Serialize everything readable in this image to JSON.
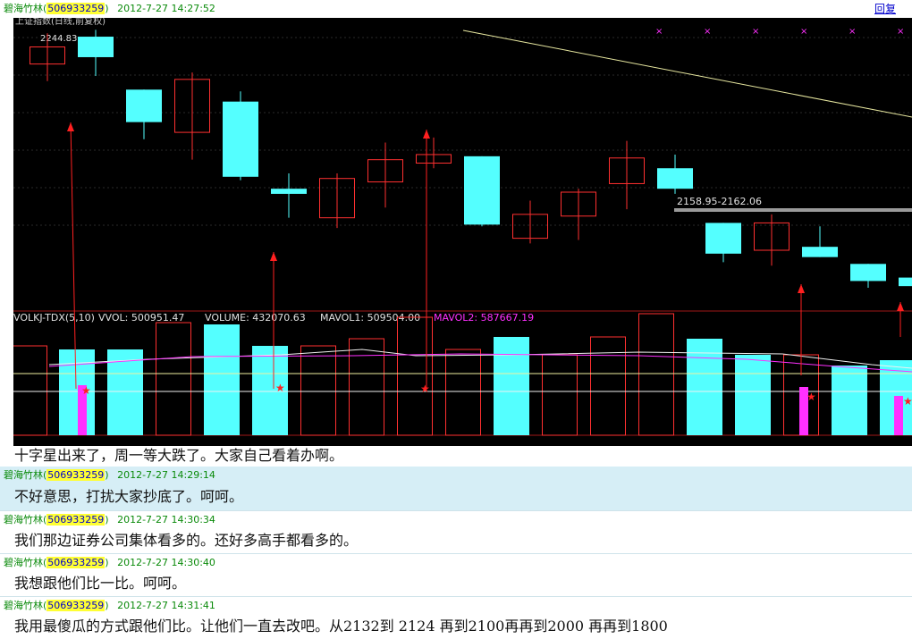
{
  "reply_label": "回复",
  "messages": [
    {
      "name": "碧海竹林",
      "qq": "506933259",
      "time": "2012-7-27 14:27:52",
      "text": ""
    },
    {
      "name": "",
      "qq": "",
      "time": "",
      "text": "十字星出来了，周一等大跌了。大家自己看着办啊。"
    },
    {
      "name": "碧海竹林",
      "qq": "506933259",
      "time": "2012-7-27 14:29:14",
      "text": "不好意思，打扰大家抄底了。呵呵。"
    },
    {
      "name": "碧海竹林",
      "qq": "506933259",
      "time": "2012-7-27 14:30:34",
      "text": "我们那边证券公司集体看多的。还好多高手都看多的。"
    },
    {
      "name": "碧海竹林",
      "qq": "506933259",
      "time": "2012-7-27 14:30:40",
      "text": "我想跟他们比一比。呵呵。"
    },
    {
      "name": "碧海竹林",
      "qq": "506933259",
      "time": "2012-7-27 14:31:41",
      "text": "我用最傻瓜的方式跟他们比。让他们一直去改吧。从2132到  2124    再到2100再再到2000    再再到1800"
    }
  ],
  "chart_data": {
    "type": "candlestick",
    "title": "上证指数(日线,前复权)",
    "price_label_high": "2244.83",
    "price_range_label": "2158.95-2162.06",
    "candles": [
      {
        "open": 2228,
        "close": 2238,
        "high": 2246,
        "low": 2218,
        "up": true
      },
      {
        "open": 2232,
        "close": 2244,
        "high": 2248,
        "low": 2221,
        "up": false
      },
      {
        "open": 2213,
        "close": 2194,
        "high": 2213,
        "low": 2184,
        "up": false
      },
      {
        "open": 2188,
        "close": 2219,
        "high": 2223,
        "low": 2172,
        "up": true
      },
      {
        "open": 2206,
        "close": 2162,
        "high": 2212,
        "low": 2160,
        "up": false
      },
      {
        "open": 2152,
        "close": 2155,
        "high": 2164,
        "low": 2138,
        "up": false
      },
      {
        "open": 2138,
        "close": 2161,
        "high": 2164,
        "low": 2132,
        "up": true
      },
      {
        "open": 2159,
        "close": 2172,
        "high": 2182,
        "low": 2144,
        "up": true
      },
      {
        "open": 2170,
        "close": 2175,
        "high": 2185,
        "low": 2167,
        "up": true
      },
      {
        "open": 2174,
        "close": 2134,
        "high": 2174,
        "low": 2133,
        "up": false
      },
      {
        "open": 2140,
        "close": 2126,
        "high": 2148,
        "low": 2123,
        "up": true
      },
      {
        "open": 2139,
        "close": 2153,
        "high": 2155,
        "low": 2125,
        "up": true
      },
      {
        "open": 2158,
        "close": 2173,
        "high": 2183,
        "low": 2143,
        "up": true
      },
      {
        "open": 2167,
        "close": 2155,
        "high": 2175,
        "low": 2152,
        "up": false
      },
      {
        "open": 2135,
        "close": 2117,
        "high": 2135,
        "low": 2112,
        "up": false
      },
      {
        "open": 2119,
        "close": 2135,
        "high": 2140,
        "low": 2110,
        "up": true
      },
      {
        "open": 2121,
        "close": 2115,
        "high": 2133,
        "low": 2115,
        "up": false
      },
      {
        "open": 2111,
        "close": 2101,
        "high": 2111,
        "low": 2097,
        "up": false
      },
      {
        "open": 2103,
        "close": 2098,
        "high": 2103,
        "low": 2096,
        "up": false
      }
    ],
    "indicator": {
      "label": "VOLKJ-TDX(5,10)",
      "vvol": "VVOL: 500951.47",
      "volume": "VOLUME: 432070.63",
      "mavol1": "MAVOL1: 509504.00",
      "mavol2": "MAVOL2: 587667.19",
      "bars": [
        {
          "v": 50,
          "up": true
        },
        {
          "v": 48,
          "up": false
        },
        {
          "v": 48,
          "up": false
        },
        {
          "v": 63,
          "up": true
        },
        {
          "v": 62,
          "up": false
        },
        {
          "v": 50,
          "up": false
        },
        {
          "v": 50,
          "up": true
        },
        {
          "v": 54,
          "up": true
        },
        {
          "v": 66,
          "up": true
        },
        {
          "v": 48,
          "up": true
        },
        {
          "v": 55,
          "up": false
        },
        {
          "v": 45,
          "up": true
        },
        {
          "v": 55,
          "up": true
        },
        {
          "v": 68,
          "up": true
        },
        {
          "v": 54,
          "up": false
        },
        {
          "v": 45,
          "up": false
        },
        {
          "v": 45,
          "up": true
        },
        {
          "v": 39,
          "up": false
        },
        {
          "v": 42,
          "up": false
        },
        {
          "v": 36,
          "up": false
        }
      ]
    },
    "colors": {
      "up": "#ff3030",
      "down": "#54ffff",
      "magenta": "#ff30ff",
      "trend": "#e8e8a0"
    }
  }
}
